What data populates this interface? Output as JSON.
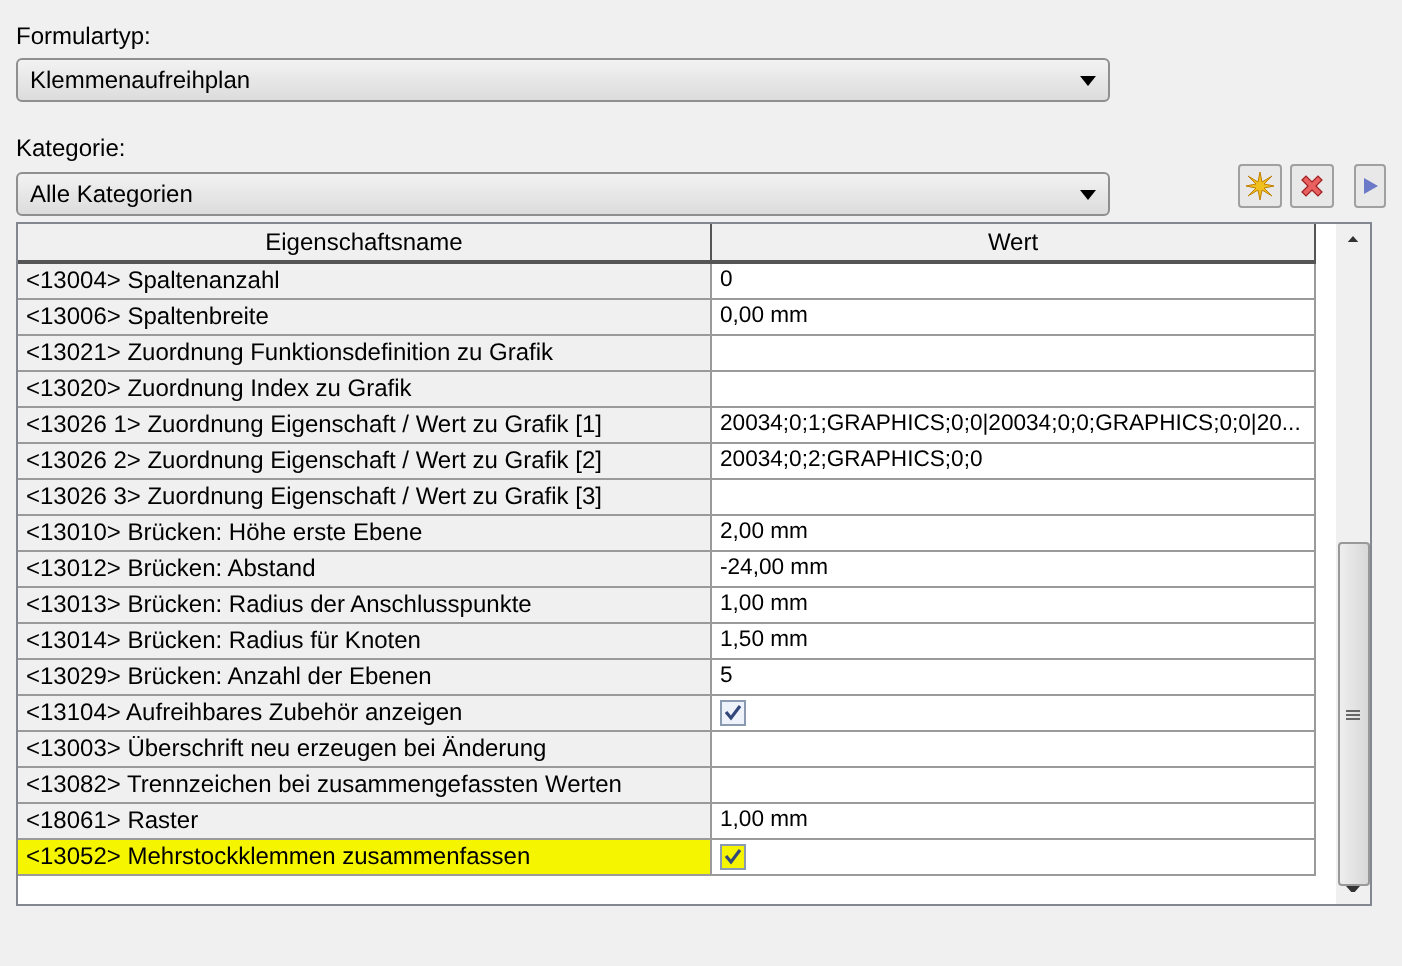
{
  "form_type": {
    "label": "Formulartyp:",
    "value": "Klemmenaufreihplan"
  },
  "category": {
    "label": "Kategorie:",
    "value": "Alle Kategorien"
  },
  "toolbar": [
    {
      "kind": "new"
    },
    {
      "kind": "delete"
    },
    {
      "kind": "play"
    }
  ],
  "table": {
    "columns": [
      "Eigenschaftsname",
      "Wert"
    ],
    "rows": [
      {
        "name": "<13004> Spaltenanzahl",
        "kind": "text",
        "value": "0",
        "highlighted": false
      },
      {
        "name": "<13006> Spaltenbreite",
        "kind": "text",
        "value": "0,00 mm",
        "highlighted": false
      },
      {
        "name": "<13021> Zuordnung Funktionsdefinition zu Grafik",
        "kind": "empty",
        "highlighted": false
      },
      {
        "name": "<13020> Zuordnung Index zu Grafik",
        "kind": "empty",
        "highlighted": false
      },
      {
        "name": "<13026 1> Zuordnung Eigenschaft / Wert zu Grafik [1]",
        "kind": "text",
        "value": "20034;0;1;GRAPHICS;0;0|20034;0;0;GRAPHICS;0;0|20...",
        "highlighted": false
      },
      {
        "name": "<13026 2> Zuordnung Eigenschaft / Wert zu Grafik [2]",
        "kind": "text",
        "value": "20034;0;2;GRAPHICS;0;0",
        "highlighted": false
      },
      {
        "name": "<13026 3> Zuordnung Eigenschaft / Wert zu Grafik [3]",
        "kind": "empty",
        "highlighted": false
      },
      {
        "name": "<13010> Brücken: Höhe erste Ebene",
        "kind": "text",
        "value": "2,00 mm",
        "highlighted": false
      },
      {
        "name": "<13012> Brücken: Abstand",
        "kind": "text",
        "value": "-24,00 mm",
        "highlighted": false
      },
      {
        "name": "<13013> Brücken: Radius der Anschlusspunkte",
        "kind": "text",
        "value": "1,00 mm",
        "highlighted": false
      },
      {
        "name": "<13014> Brücken: Radius für Knoten",
        "kind": "text",
        "value": "1,50 mm",
        "highlighted": false
      },
      {
        "name": "<13029> Brücken: Anzahl der Ebenen",
        "kind": "text",
        "value": "5",
        "highlighted": false
      },
      {
        "name": "<13104> Aufreihbares Zubehör anzeigen",
        "kind": "checkbox",
        "checked": true,
        "highlighted": false
      },
      {
        "name": "<13003> Überschrift neu erzeugen bei Änderung",
        "kind": "empty",
        "highlighted": false
      },
      {
        "name": "<13082> Trennzeichen bei zusammengefassten Werten",
        "kind": "empty",
        "highlighted": false
      },
      {
        "name": "<18061> Raster",
        "kind": "text",
        "value": "1,00 mm",
        "highlighted": false
      },
      {
        "name": "<13052> Mehrstockklemmen zusammenfassen",
        "kind": "checkbox",
        "checked": true,
        "highlighted": true
      }
    ]
  }
}
